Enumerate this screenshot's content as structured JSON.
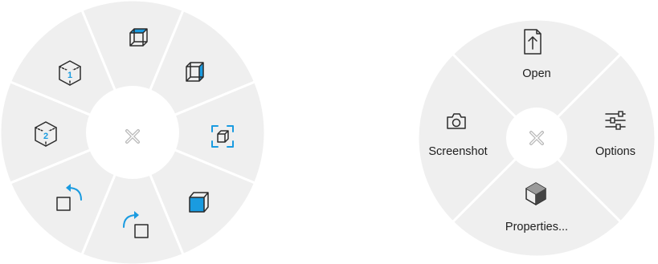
{
  "view_menu": {
    "items": [
      {
        "icon": "top-face-view-icon"
      },
      {
        "icon": "right-face-view-icon"
      },
      {
        "icon": "fit-to-screen-icon"
      },
      {
        "icon": "front-face-view-icon"
      },
      {
        "icon": "rotate-counterclockwise-icon"
      },
      {
        "icon": "rotate-clockwise-icon"
      },
      {
        "icon": "custom-view-2-icon",
        "number": "2"
      },
      {
        "icon": "custom-view-1-icon",
        "number": "1"
      }
    ],
    "center": {
      "icon": "close-icon"
    }
  },
  "file_menu": {
    "open_label": "Open",
    "options_label": "Options",
    "properties_label": "Properties...",
    "screenshot_label": "Screenshot",
    "center": {
      "icon": "close-icon"
    }
  },
  "colors": {
    "accent": "#1a9be0",
    "segment": "#efefef",
    "background": "#ffffff"
  }
}
